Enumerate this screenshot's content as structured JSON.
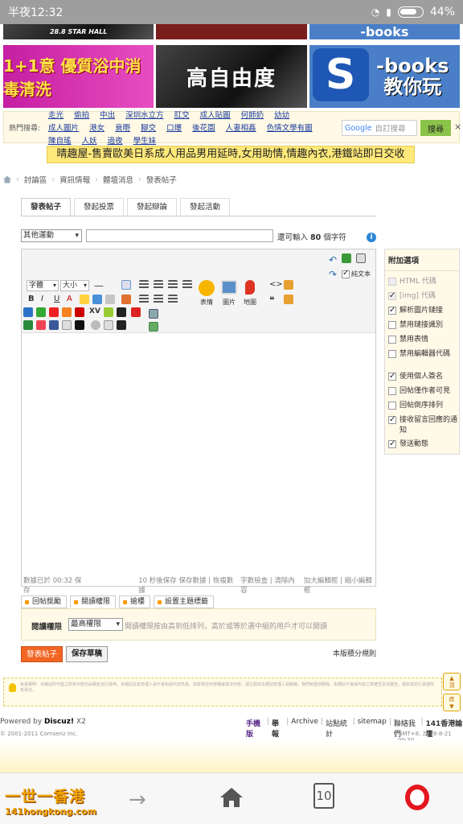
{
  "status_bar": {
    "time": "半夜12:32",
    "battery": "44%"
  },
  "banners_top": {
    "b1": "28.8 STAR HALL",
    "b3": "-books"
  },
  "banners": {
    "b1": "1+1意 優質浴中消毒清洗",
    "b2": "高自由度",
    "b3_logo": "S",
    "b3_line1": "-books",
    "b3_line2": "教你玩"
  },
  "hot_search": {
    "label": "熱門搜尋:",
    "links": [
      "走光",
      "偷拍",
      "中出",
      "深圳水立方",
      "肛交",
      "成人貼圖",
      "何師奶",
      "幼幼",
      "成人圖片",
      "港女",
      "衰嘢",
      "腳交",
      "口爆",
      "後花園",
      "人妻相姦",
      "色情文學有圖",
      "陳自瑤",
      "人妖",
      "過夜",
      "學生妹"
    ],
    "google_label": "Google",
    "search_placeholder": "自訂搜尋",
    "search_button": "搜尋",
    "close": "×"
  },
  "ad_text": "晴趣屋-售賣歐美日系成人用品男用延時,女用助情,情趣內衣,港鐵站即日交收",
  "breadcrumb": [
    "討論區",
    "資訊情報",
    "體壇消息",
    "發表帖子"
  ],
  "tabs": [
    "發表帖子",
    "發起投票",
    "發起辯論",
    "發起活動"
  ],
  "post_form": {
    "category": "其他運動",
    "limit_prefix": "還可輸入",
    "limit_value": "80",
    "limit_suffix": "個字符",
    "info_icon": "i"
  },
  "toolbar": {
    "font": "字體",
    "size": "大小",
    "plain_text": "純文本",
    "emoticon": "表情",
    "image": "圖片",
    "map": "地圖",
    "bold": "B",
    "italic": "I",
    "underline": "U",
    "color": "A"
  },
  "editor_status": {
    "saved": "數據已於 00:32 保存",
    "autosave": "10 秒後保存 保存數據 | 恢複數據",
    "check": "字數檢查 | 清除內容",
    "resize": "加大編輯框 | 縮小編輯框"
  },
  "side_options": {
    "title": "附加選項",
    "items": [
      {
        "label": "HTML 代碼",
        "checked": false,
        "disabled": true
      },
      {
        "label": "[img] 代碼",
        "checked": true,
        "disabled": true
      },
      {
        "label": "解析圖片鏈接",
        "checked": true,
        "disabled": false
      },
      {
        "label": "禁用鏈接識別",
        "checked": false,
        "disabled": false
      },
      {
        "label": "禁用表情",
        "checked": false,
        "disabled": false
      },
      {
        "label": "禁用編輯器代碼",
        "checked": false,
        "disabled": false
      },
      {
        "label": "使用個人簽名",
        "checked": true,
        "disabled": false
      },
      {
        "label": "回帖僅作者可見",
        "checked": false,
        "disabled": false
      },
      {
        "label": "回帖倒序排列",
        "checked": false,
        "disabled": false
      },
      {
        "label": "接收留言回應的通知",
        "checked": true,
        "disabled": false
      },
      {
        "label": "發送動態",
        "checked": true,
        "disabled": false
      }
    ]
  },
  "sub_tabs": [
    "回帖獎勵",
    "閱讀權限",
    "搶樓",
    "設置主題標籤"
  ],
  "permission": {
    "label": "閱讀權限",
    "value": "最高權限",
    "hint": "閱讀權限按由高到低排列，高於或等於選中組的用戶才可以閱讀"
  },
  "buttons": {
    "post": "發表帖子",
    "draft": "保存草稿",
    "rules": "本版積分規則"
  },
  "float_buttons": {
    "top": "頂",
    "bottom": "底"
  },
  "disclaimer": "免責聲明：本網站所刊登之所有內容均由網友自行發佈，本網站及其管理人員不會對該內容負責。如發現任何侵權或違法內容，請立即與本網站管理人員聯絡，我們將盡快刪除。本網站不擔保內容之準確性及完整性，網友需自行承擔所有責任。",
  "footer": {
    "powered_by": "Powered by",
    "discuz": "Discuz!",
    "version": "X2",
    "links": [
      "手機版",
      "舉報",
      "Archive",
      "站點統計",
      "sitemap",
      "聯絡我們",
      "141香港論壇"
    ],
    "copyright": "© 2001-2011 Comsenz Inc.",
    "gmt": "GMT+8, 2018-8-21 00:30"
  },
  "bottom_bar": {
    "logo_line1": "一世一香港",
    "logo_line2": "141hongkong.com",
    "tabs_count": "10"
  },
  "colors": {
    "accent": "#f26522",
    "link": "#1a3b9c",
    "ad_bg": "#ffe97a"
  }
}
